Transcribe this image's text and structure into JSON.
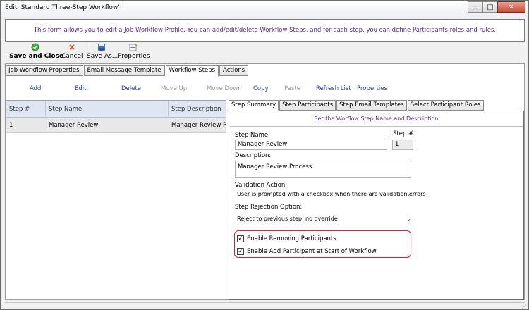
{
  "window": {
    "title": "Edit 'Standard Three-Step Workflow'",
    "minimize_glyph": "▭",
    "maximize_glyph": "□",
    "close_glyph": "✕"
  },
  "info": {
    "text": "This form allows you to edit a Job Workflow Profile. You can add/edit/delete Workflow Steps, and for each step, you can define Participants roles and rules."
  },
  "toolbar": {
    "save_close": "Save and Close",
    "cancel": "Cancel",
    "save_as": "Save As...",
    "properties": "Properties",
    "icons": {
      "save_close": "check-circle-icon",
      "cancel": "x-icon",
      "save_as": "floppy-disk-icon",
      "properties": "properties-icon"
    }
  },
  "main_tabs": [
    "Job Workflow Properties",
    "Email Message Template",
    "Workflow Steps",
    "Actions"
  ],
  "actions": {
    "add": "Add",
    "edit": "Edit",
    "delete": "Delete",
    "move_up": "Move Up",
    "move_down": "Move Down",
    "copy": "Copy",
    "paste": "Paste",
    "refresh_list": "Refresh List",
    "properties": "Properties"
  },
  "grid": {
    "columns": [
      "Step #",
      "Step Name",
      "Step Description"
    ],
    "rows": [
      {
        "step": "1",
        "name": "Manager Review",
        "description": "Manager Review Process."
      }
    ]
  },
  "sub_tabs": [
    "Step Summary",
    "Step Participants",
    "Step Email Templates",
    "Select Participant Roles"
  ],
  "step_summary": {
    "description_banner": "Set the Worflow Step Name and Description",
    "step_name_label": "Step Name:",
    "step_name_value": "Manager Review",
    "step_num_label": "Step #",
    "step_num_value": "1",
    "description_label": "Description:",
    "description_value": "Manager Review Process.",
    "validation_label": "Validation Action:",
    "validation_value": "User is prompted with a checkbox when there are validation errors",
    "rejection_label": "Step Rejection Option:",
    "rejection_value": "Reject to previous step, no override",
    "enable_removing": "Enable Removing Participants",
    "enable_add": "Enable Add Participant at Start of Workflow",
    "check_glyph": "✓",
    "chevron_glyph": "⌄"
  }
}
